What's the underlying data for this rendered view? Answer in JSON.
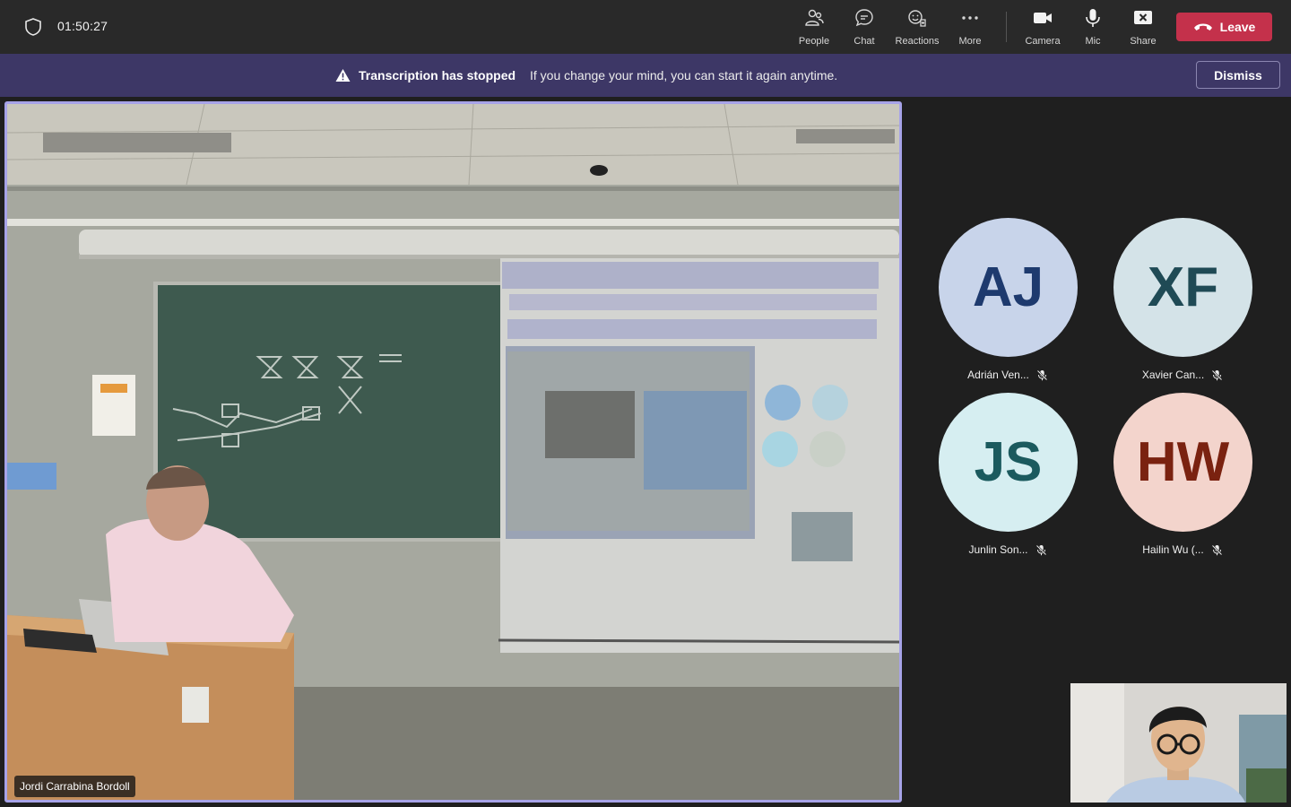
{
  "meeting": {
    "timer": "01:50:27"
  },
  "toolbar": {
    "people_label": "People",
    "chat_label": "Chat",
    "reactions_label": "Reactions",
    "more_label": "More",
    "camera_label": "Camera",
    "mic_label": "Mic",
    "share_label": "Share",
    "leave_label": "Leave"
  },
  "banner": {
    "title": "Transcription has stopped",
    "message": "If you change your mind, you can start it again anytime.",
    "dismiss_label": "Dismiss"
  },
  "main_video": {
    "speaker_name": "Jordi Carrabina Bordoll"
  },
  "participants": [
    {
      "initials": "AJ",
      "name": "Adrián Ven...",
      "bg": "#c8d4ea",
      "fg": "#1e3a6e",
      "muted": true
    },
    {
      "initials": "XF",
      "name": "Xavier Can...",
      "bg": "#d4e3e8",
      "fg": "#1f4a55",
      "muted": true
    },
    {
      "initials": "JS",
      "name": "Junlin Son...",
      "bg": "#d6eef1",
      "fg": "#1b5a5e",
      "muted": true
    },
    {
      "initials": "HW",
      "name": "Hailin Wu (...",
      "bg": "#f3d4cc",
      "fg": "#7a2210",
      "muted": true
    }
  ],
  "colors": {
    "topbar": "#292929",
    "banner": "#3d3766",
    "leave": "#c4314b",
    "active_speaker_border": "#a7a3e8"
  },
  "icons": {
    "shield": "shield-icon",
    "people": "people-icon",
    "chat": "chat-icon",
    "reactions": "reactions-icon",
    "more": "more-icon",
    "camera": "camera-icon",
    "mic": "mic-icon",
    "share": "share-icon",
    "leave": "phone-hangup-icon",
    "warning": "warning-icon",
    "muted": "mic-off-icon"
  }
}
